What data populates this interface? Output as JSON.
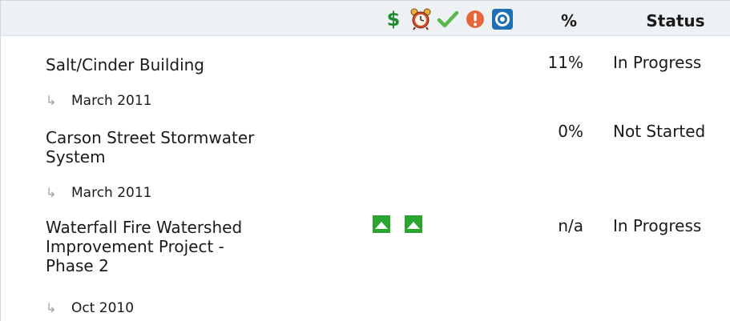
{
  "header": {
    "icons": [
      "dollar-icon",
      "alarm-clock-icon",
      "checkmark-icon",
      "alert-icon",
      "target-icon"
    ],
    "dollar_symbol": "$",
    "percent_label": "%",
    "status_label": "Status"
  },
  "rows": [
    {
      "title_lines": [
        "Salt/Cinder Building"
      ],
      "percent": "11%",
      "status": "In Progress",
      "date": "March 2011",
      "indicators": []
    },
    {
      "title_lines": [
        "Carson Street Stormwater",
        "System"
      ],
      "percent": "0%",
      "status": "Not Started",
      "date": "March 2011",
      "indicators": []
    },
    {
      "title_lines": [
        "Waterfall Fire Watershed",
        "Improvement Project -",
        "Phase 2"
      ],
      "percent": "n/a",
      "status": "In Progress",
      "date": "Oct 2010",
      "indicators": [
        "up-triangle-icon",
        "up-triangle-icon"
      ]
    }
  ],
  "date_arrow": "↳",
  "colors": {
    "header_bg": "#eef1f4",
    "dollar_green": "#1f8c2b",
    "indicator_green": "#2aa52f",
    "alert_orange": "#e8643a",
    "target_blue": "#1f6fb5"
  }
}
